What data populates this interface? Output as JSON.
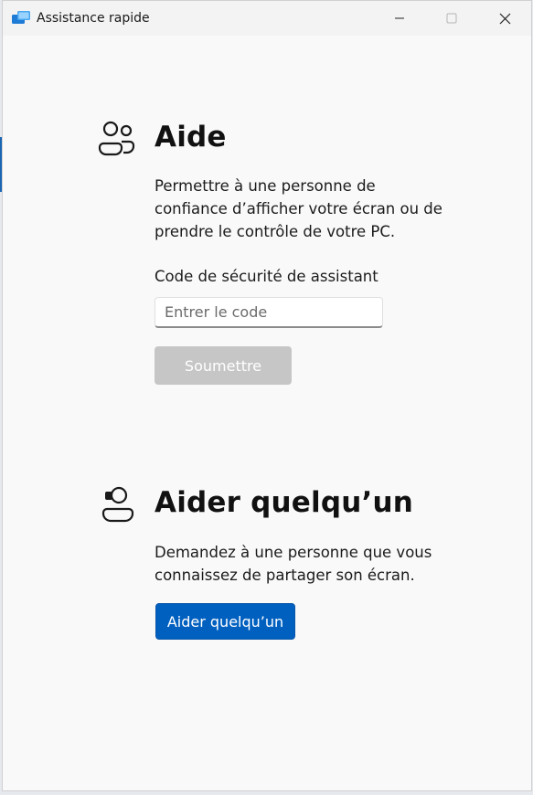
{
  "window": {
    "title": "Assistance rapide",
    "app_icon": "quick-assist-icon",
    "controls": [
      "minimize-icon",
      "maximize-icon",
      "close-icon"
    ]
  },
  "get_help": {
    "icon": "people-icon",
    "heading": "Aide",
    "description": "Permettre à une personne de confiance d’afficher votre écran ou de prendre le contrôle de votre PC.",
    "code_label": "Code de sécurité de assistant",
    "code_placeholder": "Entrer le code",
    "code_value": "",
    "submit_label": "Soumettre"
  },
  "give_help": {
    "icon": "person-support-icon",
    "heading": "Aider quelqu’un",
    "description": "Demandez à une personne que vous connaissez de partager son écran.",
    "button_label": "Aider quelqu’un"
  },
  "colors": {
    "accent": "#0060c0",
    "disabled_button": "#c6c6c6",
    "window_bg": "#f9f9f9"
  }
}
